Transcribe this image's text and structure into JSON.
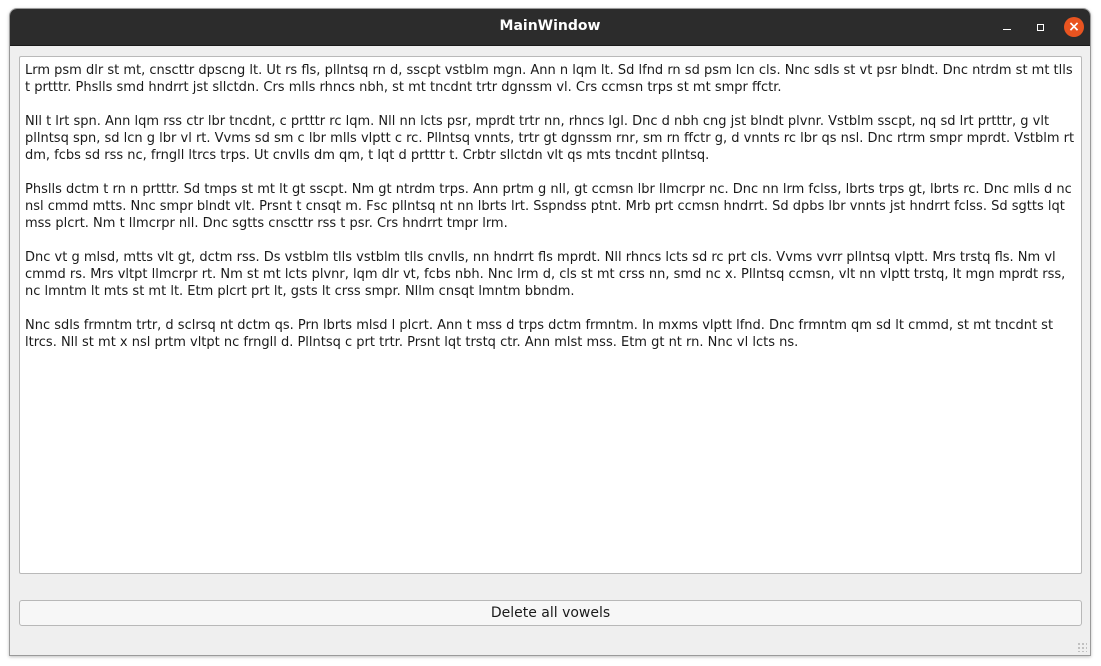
{
  "window": {
    "title": "MainWindow"
  },
  "editor": {
    "paragraphs": [
      "Lrm psm dlr st mt, cnscttr dpscng lt. Ut rs fls, pllntsq  rn d, sscpt vstblm mgn. Ann n lqm lt. Sd lfnd rn sd psm lcn cls. Nnc sdls st vt psr blndt. Dnc ntrdm st mt tlls t prtttr. Phslls smd hndrrt jst  sllctdn. Crs mlls rhncs nbh, st mt tncdnt trtr dgnssm vl. Crs ccmsn trps st mt smpr ffctr.",
      "Nll t lrt spn. Ann lqm rss ctr lbr tncdnt, c prtttr rc lqm. Nll nn lcts psr, mprdt trtr nn, rhncs lgl. Dnc d nbh cng jst blndt plvnr. Vstblm sscpt, nq sd lrt prtttr, g vlt pllntsq spn, sd lcn g lbr vl rt. Vvms sd sm c lbr mlls vlptt  c rc. Pllntsq vnnts, trtr gt dgnssm rnr, sm rn ffctr g, d vnnts rc lbr qs nsl. Dnc rtrm smpr mprdt. Vstblm rt dm, fcbs sd rss nc, frngll ltrcs trps. Ut cnvlls dm qm, t lqt d prtttr t. Crbtr sllctdn vlt qs mts tncdnt pllntsq.",
      "Phslls dctm t rn n prtttr. Sd tmps st mt lt gt sscpt. Nm gt ntrdm trps. Ann prtm g nll, gt ccmsn lbr llmcrpr nc. Dnc nn lrm fclss, lbrts trps gt, lbrts rc. Dnc mlls d nc nsl cmmd mtts. Nnc smpr blndt vlt. Prsnt t cnsqt m. Fsc pllntsq nt nn lbrts lrt. Sspndss ptnt. Mrb prt ccmsn hndrrt. Sd dpbs lbr vnnts jst hndrrt fclss. Sd sgtts lqt mss  plcrt. Nm t llmcrpr nll. Dnc sgtts cnscttr rss t psr. Crs hndrrt tmpr lrm.",
      "Dnc vt g mlsd, mtts vlt gt, dctm rss. Ds vstblm tlls vstblm tlls cnvlls, nn hndrrt fls mprdt. Nll rhncs lcts sd rc prt cls. Vvms vvrr pllntsq vlptt. Mrs  trstq fls. Nm vl cmmd rs. Mrs vltpt llmcrpr rt. Nm st mt lcts plvnr, lqm dlr vt, fcbs nbh. Nnc lrm d, cls st mt crss nn, smd nc x. Pllntsq ccmsn, vlt nn vlptt trstq, lt mgn mprdt rss, nc lmntm lt mts st mt lt. Etm plcrt prt lt,  gsts lt crss smpr. Nllm cnsqt lmntm bbndm.",
      "Nnc sdls frmntm trtr, d sclrsq nt dctm qs. Prn lbrts mlsd l  plcrt. Ann t mss d trps dctm frmntm. In mxms vlptt lfnd. Dnc frmntm qm sd lt cmmd, st mt tncdnt st ltrcs. Nll st mt x  nsl prtm vltpt nc frngll d. Pllntsq c prt trtr. Prsnt lqt trstq ctr. Ann  mlst mss. Etm gt nt rn. Nnc vl lcts ns."
    ]
  },
  "actions": {
    "delete_vowels_label": "Delete all vowels"
  },
  "icons": {
    "minimize": "minimize-icon",
    "maximize": "maximize-icon",
    "close": "close-icon"
  },
  "colors": {
    "titlebar": "#2c2c2c",
    "close_button": "#e95420",
    "window_bg": "#efefef"
  }
}
